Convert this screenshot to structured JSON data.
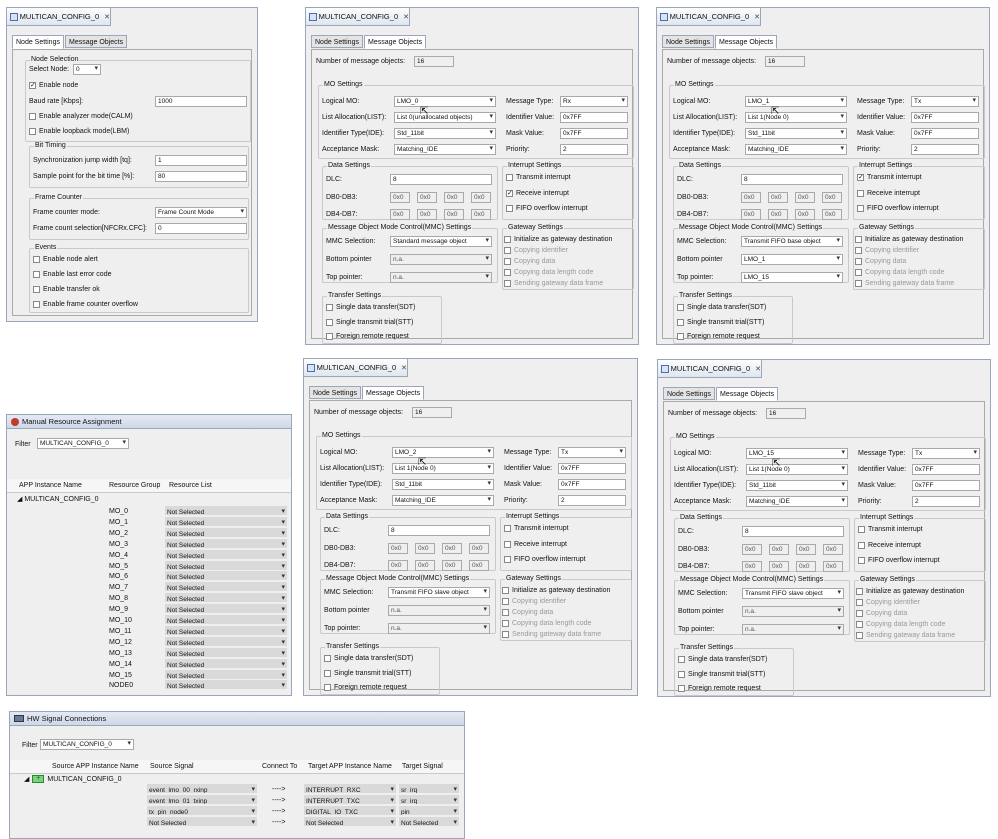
{
  "node_settings_panel": {
    "tab_title": "MULTICAN_CONFIG_0",
    "tabs": [
      "Node Settings",
      "Message Objects"
    ],
    "node_selection": {
      "group": "Node Selection",
      "select_node_label": "Select Node:",
      "select_node_value": "0",
      "enable_node": "Enable node",
      "baud_rate_label": "Baud rate [Kbps]:",
      "baud_rate_value": "1000",
      "analyzer_mode": "Enable analyzer mode(CALM)",
      "loopback_mode": "Enable loopback mode(LBM)"
    },
    "bit_timing": {
      "group": "Bit Timing",
      "sjw_label": "Synchronization jump width [tq]:",
      "sjw_value": "1",
      "sample_point_label": "Sample point for the bit time [%]:",
      "sample_point_value": "80"
    },
    "frame_counter": {
      "group": "Frame Counter",
      "mode_label": "Frame counter mode:",
      "mode_value": "Frame Count Mode",
      "selection_label": "Frame count selection[NFCRx.CFC]:",
      "selection_value": "0"
    },
    "events": {
      "group": "Events",
      "items": [
        "Enable node alert",
        "Enable last error code",
        "Enable transfer ok",
        "Enable frame counter overflow"
      ]
    }
  },
  "mo_labels": {
    "tab_title": "MULTICAN_CONFIG_0",
    "tabs": [
      "Node Settings",
      "Message Objects"
    ],
    "num_objects_label": "Number of message objects:",
    "mo_settings": "MO Settings",
    "logical_mo": "Logical MO:",
    "list_alloc": "List Allocation(LIST):",
    "identifier_type": "Identifier Type(IDE):",
    "acceptance_mask": "Acceptance Mask:",
    "message_type": "Message Type:",
    "identifier_value": "Identifier Value:",
    "mask_value": "Mask Value:",
    "priority": "Priority:",
    "data_settings": "Data Settings",
    "dlc": "DLC:",
    "db0_db3": "DB0-DB3:",
    "db4_db7": "DB4-DB7:",
    "interrupt_settings": "Interrupt Settings",
    "transmit_interrupt": "Transmit interrupt",
    "receive_interrupt": "Receive interrupt",
    "fifo_overflow": "FIFO overflow interrupt",
    "mmc_group": "Message Object Mode Control(MMC) Settings",
    "mmc_selection": "MMC Selection:",
    "bottom_pointer": "Bottom pointer",
    "top_pointer": "Top pointer:",
    "gateway_settings": "Gateway Settings",
    "gw_init": "Initialize as gateway destination",
    "gw_copy_id": "Copying identifier",
    "gw_copy_data": "Copying data",
    "gw_copy_dlc": "Copying data length code",
    "gw_send": "Sending gateway data frame",
    "transfer_settings": "Transfer Settings",
    "sdt": "Single data transfer(SDT)",
    "stt": "Single transmit trial(STT)",
    "frq": "Foreign remote request"
  },
  "mo_panels": [
    {
      "num_objects": "16",
      "logical_mo": "LMO_0",
      "list_alloc": "List 0(unallocated objects)",
      "identifier_type": "Std_11bit",
      "acceptance_mask": "Matching_IDE",
      "message_type": "Rx",
      "identifier_value": "0x7FF",
      "mask_value": "0x7FF",
      "priority": "2",
      "dlc": "8",
      "hex": "0x0",
      "tx_int": false,
      "rx_int": true,
      "fifo_int": false,
      "mmc": "Standard message object",
      "bottom": "n.a.",
      "top": "n.a."
    },
    {
      "num_objects": "16",
      "logical_mo": "LMO_1",
      "list_alloc": "List 1(Node 0)",
      "identifier_type": "Std_11bit",
      "acceptance_mask": "Matching_IDE",
      "message_type": "Tx",
      "identifier_value": "0x7FF",
      "mask_value": "0x7FF",
      "priority": "2",
      "dlc": "8",
      "hex": "0x0",
      "tx_int": true,
      "rx_int": false,
      "fifo_int": false,
      "mmc": "Transmit FIFO base object",
      "bottom": "LMO_1",
      "top": "LMO_15"
    },
    {
      "num_objects": "16",
      "logical_mo": "LMO_2",
      "list_alloc": "List 1(Node 0)",
      "identifier_type": "Std_11bit",
      "acceptance_mask": "Matching_IDE",
      "message_type": "Tx",
      "identifier_value": "0x7FF",
      "mask_value": "0x7FF",
      "priority": "2",
      "dlc": "8",
      "hex": "0x0",
      "tx_int": false,
      "rx_int": false,
      "fifo_int": false,
      "mmc": "Transmit FIFO slave object",
      "bottom": "n.a.",
      "top": "n.a."
    },
    {
      "num_objects": "16",
      "logical_mo": "LMO_15",
      "list_alloc": "List 1(Node 0)",
      "identifier_type": "Std_11bit",
      "acceptance_mask": "Matching_IDE",
      "message_type": "Tx",
      "identifier_value": "0x7FF",
      "mask_value": "0x7FF",
      "priority": "2",
      "dlc": "8",
      "hex": "0x0",
      "tx_int": false,
      "rx_int": false,
      "fifo_int": false,
      "mmc": "Transmit FIFO slave object",
      "bottom": "n.a.",
      "top": "n.a."
    }
  ],
  "manual_resource": {
    "title": "Manual Resource Assignment",
    "filter_label": "Filter",
    "filter_value": "MULTICAN_CONFIG_0",
    "columns": [
      "APP Instance Name",
      "Resource Group",
      "Resource List"
    ],
    "instance": "MULTICAN_CONFIG_0",
    "rows": [
      {
        "group": "MO_0",
        "list": "Not Selected"
      },
      {
        "group": "MO_1",
        "list": "Not Selected"
      },
      {
        "group": "MO_2",
        "list": "Not Selected"
      },
      {
        "group": "MO_3",
        "list": "Not Selected"
      },
      {
        "group": "MO_4",
        "list": "Not Selected"
      },
      {
        "group": "MO_5",
        "list": "Not Selected"
      },
      {
        "group": "MO_6",
        "list": "Not Selected"
      },
      {
        "group": "MO_7",
        "list": "Not Selected"
      },
      {
        "group": "MO_8",
        "list": "Not Selected"
      },
      {
        "group": "MO_9",
        "list": "Not Selected"
      },
      {
        "group": "MO_10",
        "list": "Not Selected"
      },
      {
        "group": "MO_11",
        "list": "Not Selected"
      },
      {
        "group": "MO_12",
        "list": "Not Selected"
      },
      {
        "group": "MO_13",
        "list": "Not Selected"
      },
      {
        "group": "MO_14",
        "list": "Not Selected"
      },
      {
        "group": "MO_15",
        "list": "Not Selected"
      },
      {
        "group": "NODE0",
        "list": "Not Selected"
      }
    ]
  },
  "hw_signal": {
    "title": "HW Signal Connections",
    "filter_label": "Filter",
    "filter_value": "MULTICAN_CONFIG_0",
    "columns": [
      "Source APP Instance Name",
      "Source Signal",
      "Connect To",
      "Target APP Instance Name",
      "Target Signal"
    ],
    "instance": "MULTICAN_CONFIG_0",
    "rows": [
      {
        "source": "event_lmo_00_rxinp",
        "connect": "---->",
        "target_app": "INTERRUPT_RXC",
        "target_signal": "sr_irq"
      },
      {
        "source": "event_lmo_01_txinp",
        "connect": "---->",
        "target_app": "INTERRUPT_TXC",
        "target_signal": "sr_irq"
      },
      {
        "source": "tx_pin_node0",
        "connect": "---->",
        "target_app": "DIGITAL_IO_TXC",
        "target_signal": "pin"
      },
      {
        "source": "Not Selected",
        "connect": "---->",
        "target_app": "Not Selected",
        "target_signal": "Not Selected"
      }
    ]
  }
}
